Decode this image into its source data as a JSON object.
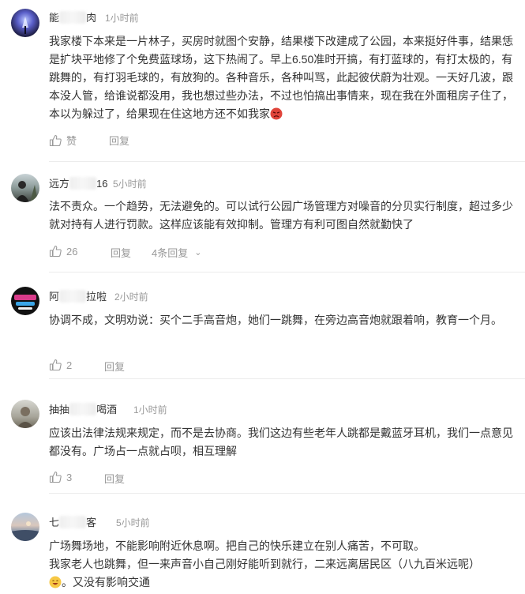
{
  "comments": [
    {
      "username_prefix": "能",
      "username_suffix": "肉",
      "time": "1小时前",
      "text": "我家楼下本来是一片林子，买房时就图个安静，结果楼下改建成了公园，本来挺好件事，结果恁是扩块平地修了个免费蓝球场，这下热闹了。早上6.50准时开搞，有打蓝球的，有打太极的，有跳舞的，有打羽毛球的，有放狗的。各种音乐，各种叫骂，此起彼伏蔚为壮观。一天好几波，跟本没人管，给谁说都没用，我也想过些办法，不过也怕搞出事情来，现在我在外面租房子住了，本以为躲过了，给果现在住这地方还不如我家",
      "emoji": "angry-face",
      "like_label": "赞",
      "reply_label": "回复"
    },
    {
      "username_prefix": "远方",
      "username_suffix": "16",
      "time": "5小时前",
      "text": "法不责众。一个趋势，无法避免的。可以试行公园广场管理方对噪音的分贝实行制度，超过多少就对持有人进行罚款。这样应该能有效抑制。管理方有利可图自然就勤快了",
      "like_count": "26",
      "reply_label": "回复",
      "replies_label": "4条回复"
    },
    {
      "username_prefix": "阿",
      "username_suffix": "拉啦",
      "time": "2小时前",
      "text": "协调不成，文明劝说：买个二手高音炮，她们一跳舞，在旁边高音炮就跟着响，教育一个月。",
      "like_count": "2",
      "reply_label": "回复"
    },
    {
      "username_prefix": "抽抽",
      "username_suffix": "喝酒",
      "time": "1小时前",
      "text": "应该出法律法规来规定，而不是去协商。我们这边有些老年人跳都是戴蓝牙耳机，我们一点意见都没有。广场占一点就占呗，相互理解",
      "like_count": "3",
      "reply_label": "回复"
    },
    {
      "username_prefix": "七",
      "username_suffix": "客",
      "time": "5小时前",
      "text_line1": "广场舞场地，不能影响附近休息啊。把自己的快乐建立在别人痛苦，不可取。",
      "text_line2": "我家老人也跳舞，但一来声音小自己刚好能听到就行，二来远离居民区（八九百米远呢）",
      "text_line3": "。又没有影响交通",
      "emoji": "grinning-face"
    }
  ],
  "colors": {
    "text": "#333333",
    "meta": "#999999",
    "divider": "#ececec"
  }
}
